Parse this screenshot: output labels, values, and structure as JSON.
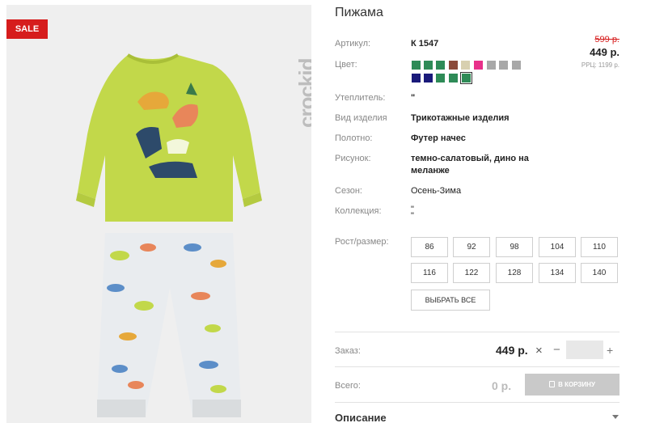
{
  "badge": {
    "sale": "SALE"
  },
  "brand": {
    "name": "crockid"
  },
  "product": {
    "title": "Пижама",
    "article_label": "Артикул:",
    "article": "К 1547",
    "old_price": "599 р.",
    "price": "449 р.",
    "rrp": "РРЦ: 1199 р.",
    "color_label": "Цвет:",
    "insulation_label": "Утеплитель:",
    "insulation": "\"",
    "type_label": "Вид изделия",
    "type": "Трикотажные изделия",
    "fabric_label": "Полотно:",
    "fabric": "Футер начес",
    "print_label": "Рисунок:",
    "print_line1": "темно-салатовый, дино на",
    "print_line2": "меланже",
    "season_label": "Сезон:",
    "season": "Осень-Зима",
    "collection_label": "Коллекция:",
    "collection_line1": "\"",
    "collection_line2": "\""
  },
  "colors": {
    "row1": [
      "#2e8b57",
      "#2e8b57",
      "#2e8b57",
      "#8b4a3a",
      "#d8d0b0",
      "#e8308a",
      "#a8a8a8",
      "#a8a8a8",
      "#a8a8a8"
    ],
    "row2": [
      "#1a1a7a",
      "#1a1a7a",
      "#2e8b57",
      "#2e8b57",
      "#2e8b57"
    ],
    "selected": "#2e8b57"
  },
  "sizes": {
    "label": "Рост/размер:",
    "row1": [
      "86",
      "92",
      "98",
      "104",
      "110"
    ],
    "row2": [
      "116",
      "122",
      "128",
      "134",
      "140"
    ],
    "select_all": "ВЫБРАТЬ ВСЕ"
  },
  "order": {
    "label": "Заказ:",
    "price": "449 р.",
    "times": "×",
    "minus": "−",
    "plus": "+",
    "quantity": ""
  },
  "total": {
    "label": "Всего:",
    "value": "0 р.",
    "cart_button": "В КОРЗИНУ"
  },
  "description": {
    "label": "Описание"
  }
}
